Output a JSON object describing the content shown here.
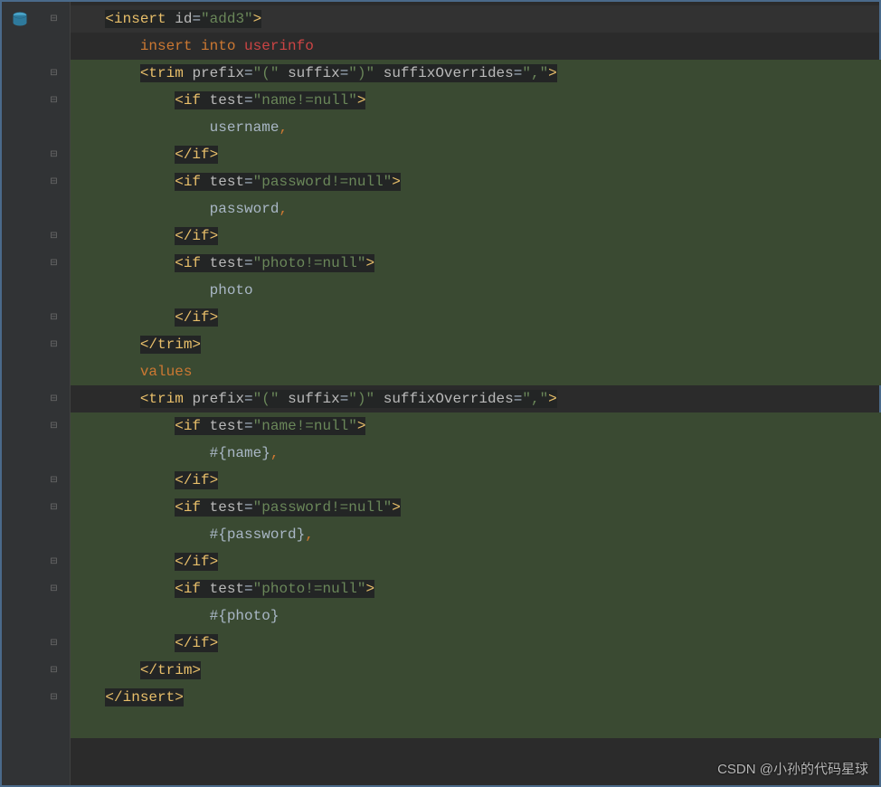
{
  "watermark": "CSDN @小孙的代码星球",
  "code": {
    "l1": {
      "indent": "    ",
      "open": "<",
      "tag": "insert",
      "sp": " ",
      "a1n": "id",
      "eq": "=",
      "a1v": "\"add3\"",
      "close": ">"
    },
    "l2": {
      "indent": "        ",
      "kw1": "insert ",
      "kw2": "into ",
      "tbl": "userinfo"
    },
    "l3": {
      "indent": "        ",
      "open": "<",
      "tag": "trim",
      "sp": " ",
      "a1n": "prefix",
      "eq": "=",
      "a1v": "\"(\"",
      "sp2": " ",
      "a2n": "suffix",
      "a2v": "\")\"",
      "sp3": " ",
      "a3n": "suffixOverrides",
      "a3v": "\",\"",
      "close": ">"
    },
    "l4": {
      "indent": "            ",
      "open": "<",
      "tag": "if",
      "sp": " ",
      "a1n": "test",
      "eq": "=",
      "a1v": "\"name!=null\"",
      "close": ">"
    },
    "l5": {
      "indent": "                ",
      "col": "username",
      "comma": ","
    },
    "l6": {
      "indent": "            ",
      "open": "</",
      "tag": "if",
      "close": ">"
    },
    "l7": {
      "indent": "            ",
      "open": "<",
      "tag": "if",
      "sp": " ",
      "a1n": "test",
      "eq": "=",
      "a1v": "\"password!=null\"",
      "close": ">"
    },
    "l8": {
      "indent": "                ",
      "col": "password",
      "comma": ","
    },
    "l9": {
      "indent": "            ",
      "open": "</",
      "tag": "if",
      "close": ">"
    },
    "l10": {
      "indent": "            ",
      "open": "<",
      "tag": "if",
      "sp": " ",
      "a1n": "test",
      "eq": "=",
      "a1v": "\"photo!=null\"",
      "close": ">"
    },
    "l11": {
      "indent": "                ",
      "col": "photo"
    },
    "l12": {
      "indent": "            ",
      "open": "</",
      "tag": "if",
      "close": ">"
    },
    "l13": {
      "indent": "        ",
      "open": "</",
      "tag": "trim",
      "close": ">"
    },
    "l14": {
      "indent": "        ",
      "kw": "values"
    },
    "l15": {
      "indent": "        ",
      "open": "<",
      "tag": "trim",
      "sp": " ",
      "a1n": "prefix",
      "eq": "=",
      "a1v": "\"(\"",
      "sp2": " ",
      "a2n": "suffix",
      "a2v": "\")\"",
      "sp3": " ",
      "a3n": "suffixOverrides",
      "a3v": "\",\"",
      "close": ">"
    },
    "l16": {
      "indent": "            ",
      "open": "<",
      "tag": "if",
      "sp": " ",
      "a1n": "test",
      "eq": "=",
      "a1v": "\"name!=null\"",
      "close": ">"
    },
    "l17": {
      "indent": "                ",
      "param": "#{name}",
      "comma": ","
    },
    "l18": {
      "indent": "            ",
      "open": "</",
      "tag": "if",
      "close": ">"
    },
    "l19": {
      "indent": "            ",
      "open": "<",
      "tag": "if",
      "sp": " ",
      "a1n": "test",
      "eq": "=",
      "a1v": "\"password!=null\"",
      "close": ">"
    },
    "l20": {
      "indent": "                ",
      "param": "#{password}",
      "comma": ","
    },
    "l21": {
      "indent": "            ",
      "open": "</",
      "tag": "if",
      "close": ">"
    },
    "l22": {
      "indent": "            ",
      "open": "<",
      "tag": "if",
      "sp": " ",
      "a1n": "test",
      "eq": "=",
      "a1v": "\"photo!=null\"",
      "close": ">"
    },
    "l23": {
      "indent": "                ",
      "param": "#{photo}"
    },
    "l24": {
      "indent": "            ",
      "open": "</",
      "tag": "if",
      "close": ">"
    },
    "l25": {
      "indent": "        ",
      "open": "</",
      "tag": "trim",
      "close": ">"
    },
    "l26": {
      "indent": "    ",
      "open": "</",
      "tag": "insert",
      "close": ">"
    }
  }
}
